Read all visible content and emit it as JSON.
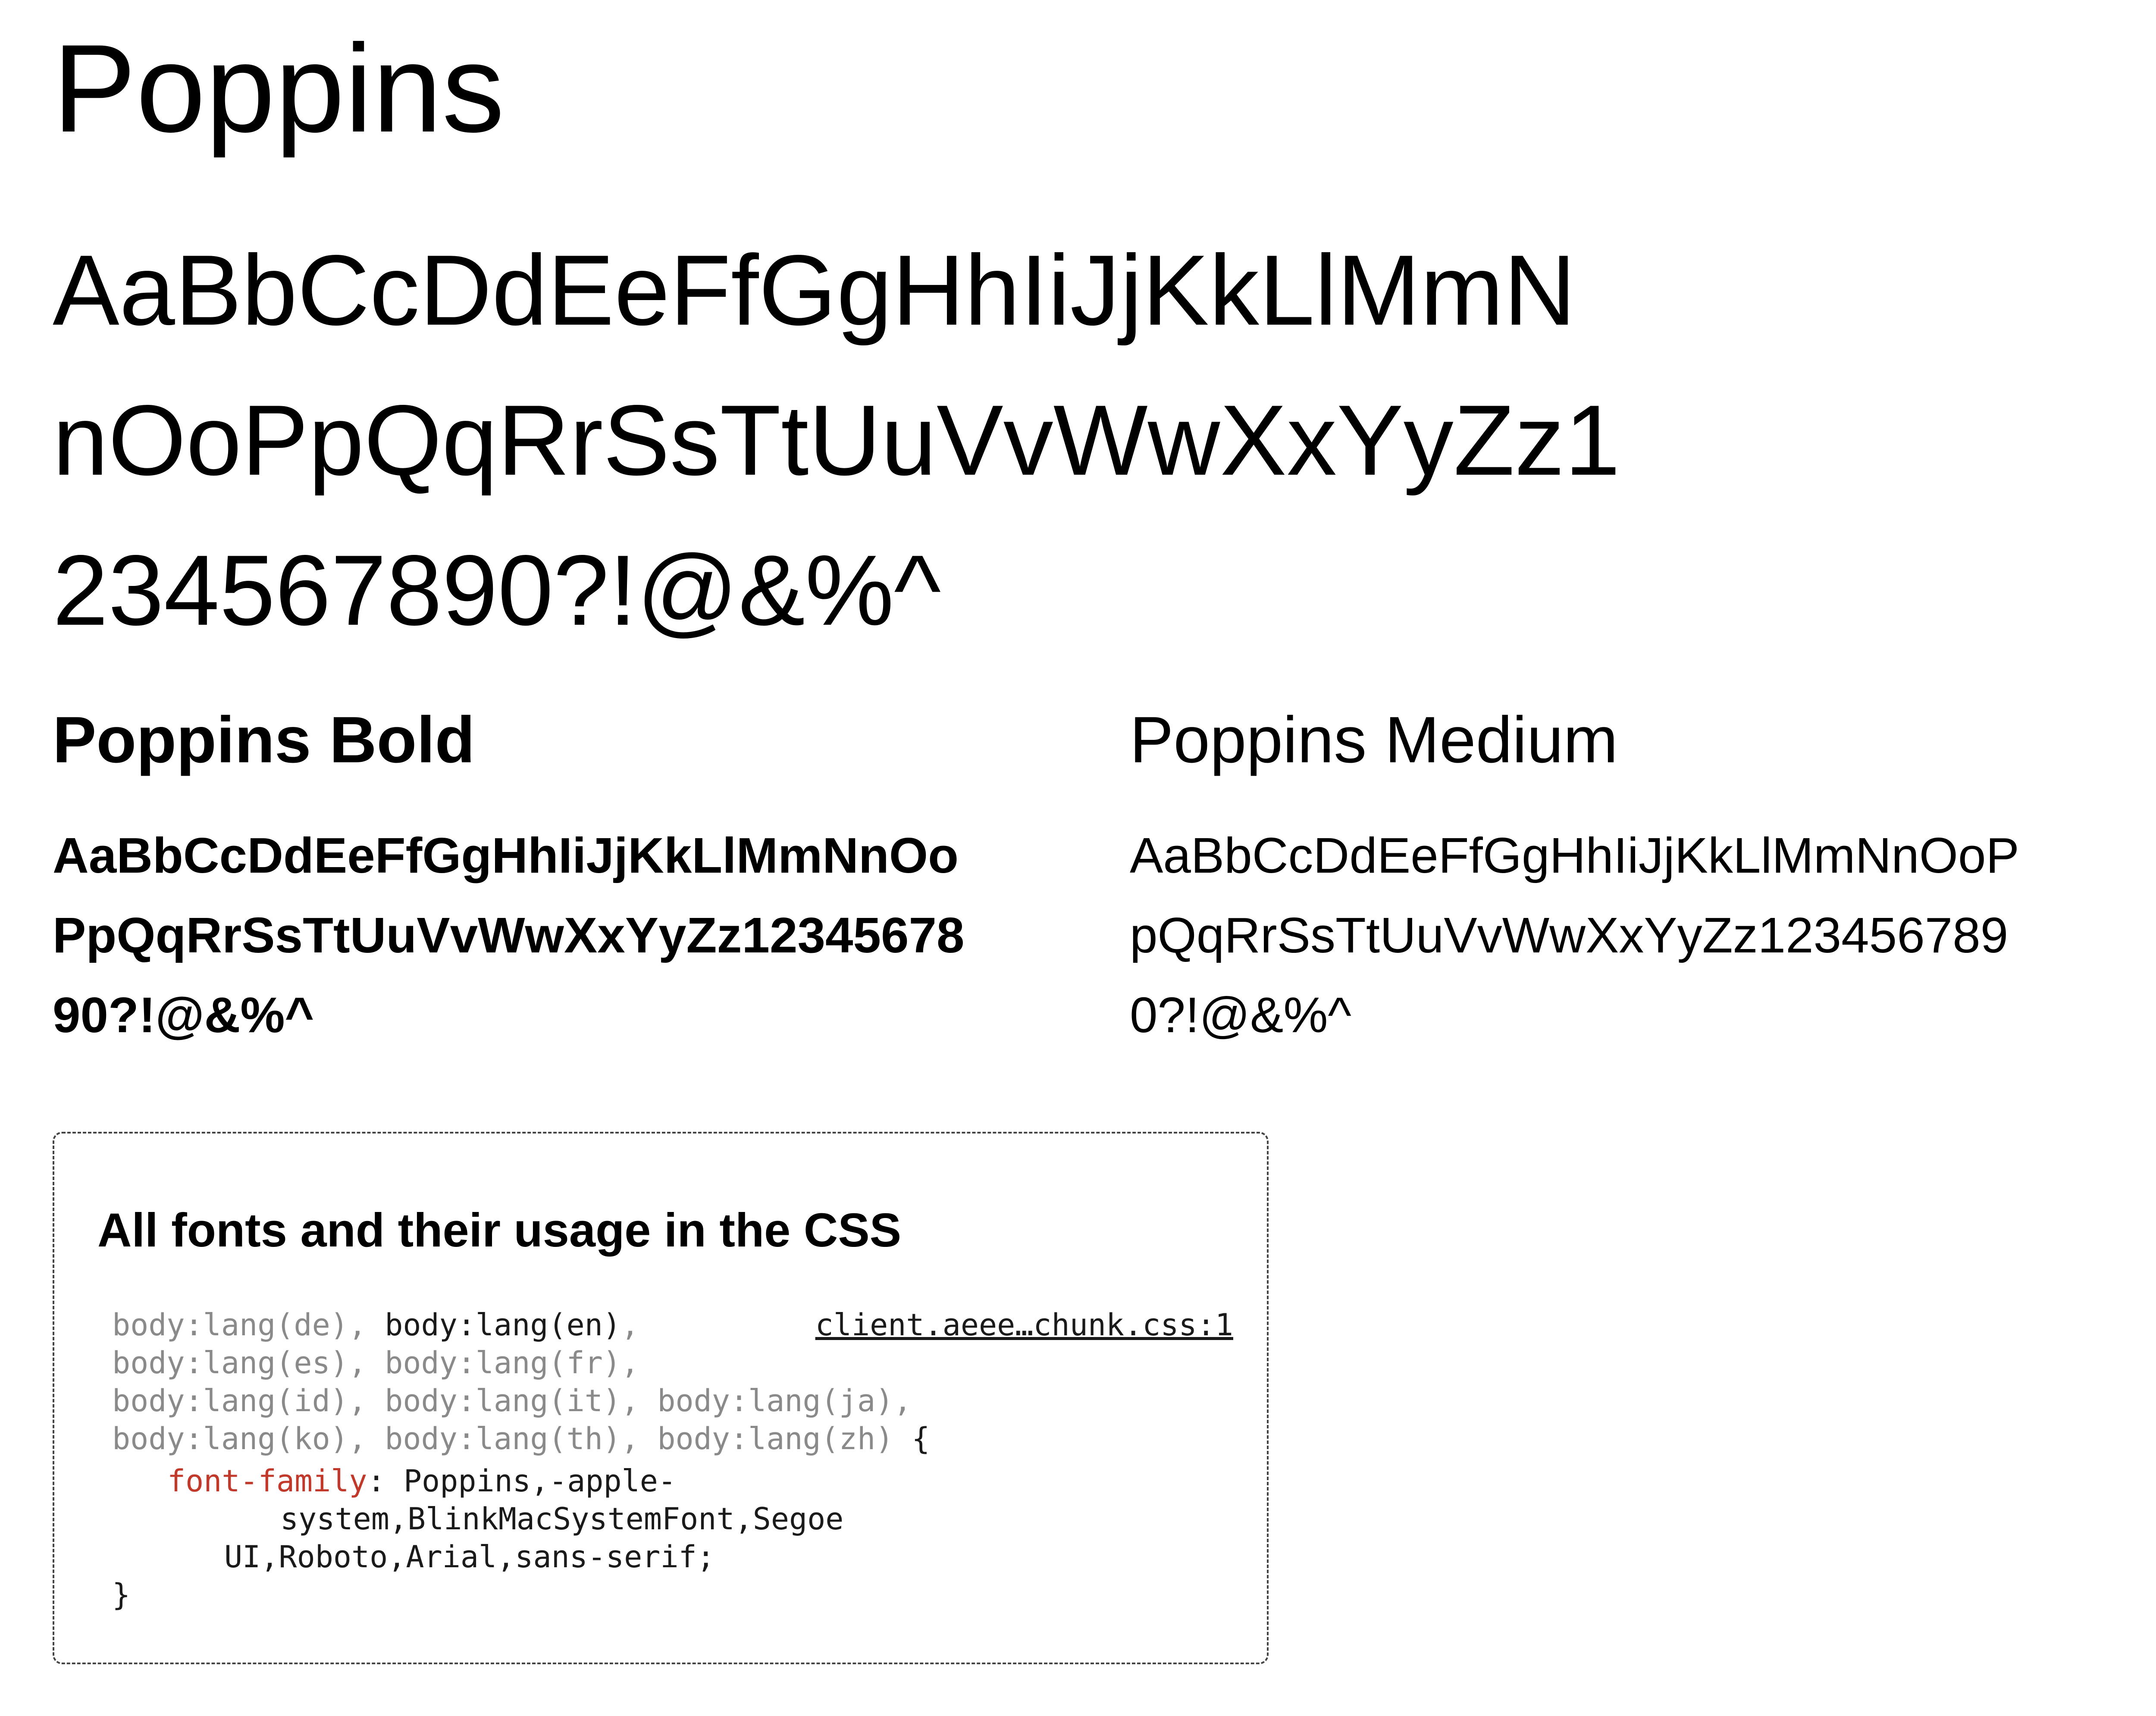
{
  "font_name": "Poppins",
  "regular_sample_lines": [
    "AaBbCcDdEeFfGgHhIiJjKkLlMmN",
    "nOoPpQqRrSsTtUuVvWwXxYyZz1",
    "234567890?!@&%^"
  ],
  "bold": {
    "title": "Poppins Bold",
    "sample_lines": [
      "AaBbCcDdEeFfGgHhIiJjKkLlMmNnOo",
      "PpQqRrSsTtUuVvWwXxYyZz12345678",
      "90?!@&%^"
    ]
  },
  "medium": {
    "title": "Poppins Medium",
    "sample_lines": [
      "AaBbCcDdEeFfGgHhIiJjKkLlMmNnOoP",
      "pQqRrSsTtUuVvWwXxYyZz123456789",
      "0?!@&%^"
    ]
  },
  "css_box": {
    "title": "All fonts and their usage in the CSS",
    "source_link": "client.aeee…chunk.css:1",
    "selectors": {
      "de": "body:lang(de)",
      "en": "body:lang(en)",
      "es": "body:lang(es)",
      "fr": "body:lang(fr)",
      "id": "body:lang(id)",
      "it": "body:lang(it)",
      "ja": "body:lang(ja)",
      "ko": "body:lang(ko)",
      "th": "body:lang(th)",
      "zh": "body:lang(zh)"
    },
    "comma": ",",
    "open_brace": "{",
    "close_brace": "}",
    "property": "font-family",
    "colon": ":",
    "value_lines": [
      "Poppins,-apple-",
      "system,BlinkMacSystemFont,Segoe",
      "UI,Roboto,Arial,sans-serif;"
    ]
  }
}
